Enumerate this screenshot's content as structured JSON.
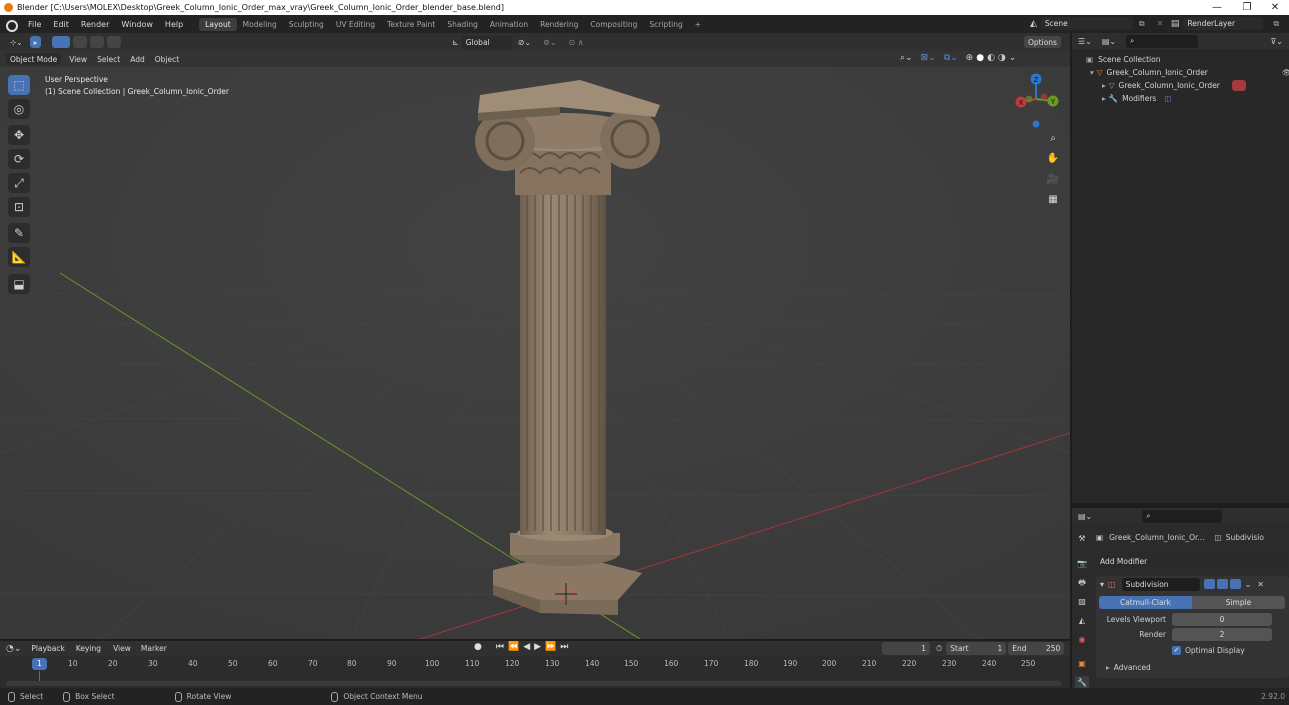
{
  "title_bar": {
    "text": "Blender [C:\\Users\\MOLEX\\Desktop\\Greek_Column_Ionic_Order_max_vray\\Greek_Column_Ionic_Order_blender_base.blend]",
    "minimize": "—",
    "restore": "❐",
    "close": "✕"
  },
  "menu": {
    "items": [
      "File",
      "Edit",
      "Render",
      "Window",
      "Help"
    ],
    "workspaces": [
      "Layout",
      "Modeling",
      "Sculpting",
      "UV Editing",
      "Texture Paint",
      "Shading",
      "Animation",
      "Rendering",
      "Compositing",
      "Scripting"
    ],
    "add_workspace": "+",
    "scene": "Scene",
    "render_layer": "RenderLayer"
  },
  "viewport": {
    "mode": "Object Mode",
    "menus": [
      "View",
      "Select",
      "Add",
      "Object"
    ],
    "orientation": "Global",
    "options": "Options",
    "overlay_title": "User Perspective",
    "overlay_subtitle": "(1) Scene Collection | Greek_Column_Ionic_Order",
    "gizmo": {
      "x": "X",
      "y": "Y",
      "z": "Z"
    }
  },
  "outliner": {
    "search_placeholder": "",
    "scene_collection": "Scene Collection",
    "object": "Greek_Column_Ionic_Order",
    "mesh": "Greek_Column_Ionic_Order",
    "modifiers": "Modifiers"
  },
  "properties": {
    "object_name": "Greek_Column_Ionic_Or...",
    "modifier_tab": "Subdivisio",
    "add_modifier": "Add Modifier",
    "modifier_name": "Subdivision",
    "catmull": "Catmull-Clark",
    "simple": "Simple",
    "levels_viewport_label": "Levels Viewport",
    "levels_viewport_value": "0",
    "render_label": "Render",
    "render_value": "2",
    "optimal_display": "Optimal Display",
    "advanced": "Advanced"
  },
  "timeline": {
    "menus": [
      "Playback",
      "Keying",
      "View",
      "Marker"
    ],
    "current_frame": "1",
    "start_label": "Start",
    "start": "1",
    "end_label": "End",
    "end": "250",
    "ticks": [
      "1",
      "10",
      "20",
      "30",
      "40",
      "50",
      "60",
      "70",
      "80",
      "90",
      "100",
      "110",
      "120",
      "130",
      "140",
      "150",
      "160",
      "170",
      "180",
      "190",
      "200",
      "210",
      "220",
      "230",
      "240",
      "250"
    ]
  },
  "status": {
    "select": "Select",
    "box_select": "Box Select",
    "rotate_view": "Rotate View",
    "context_menu": "Object Context Menu",
    "version": "2.92.0"
  },
  "colors": {
    "accent": "#4772b3",
    "viewport_bg": "#3d3d3d",
    "column": "#8b7965",
    "x_axis": "#c0393f",
    "y_axis": "#6a9a25",
    "z_axis": "#2c76d2"
  }
}
